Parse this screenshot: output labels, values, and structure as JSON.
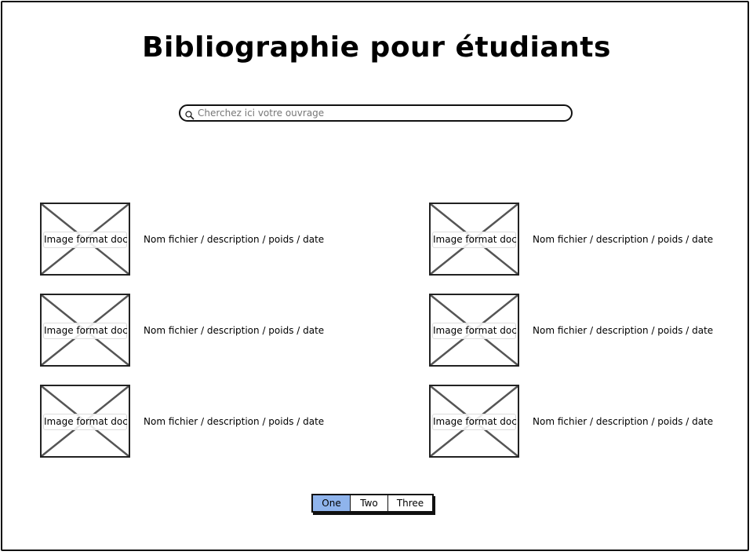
{
  "page": {
    "title": "Bibliographie pour étudiants"
  },
  "search": {
    "placeholder": "Cherchez ici votre ouvrage",
    "icon": "search-icon"
  },
  "documents": [
    {
      "thumb_label": "Image format doc",
      "description": "Nom fichier / description / poids / date"
    },
    {
      "thumb_label": "Image format doc",
      "description": "Nom fichier / description / poids / date"
    },
    {
      "thumb_label": "Image format doc",
      "description": "Nom fichier / description / poids / date"
    },
    {
      "thumb_label": "Image format doc",
      "description": "Nom fichier / description / poids / date"
    },
    {
      "thumb_label": "Image format doc",
      "description": "Nom fichier / description / poids / date"
    },
    {
      "thumb_label": "Image format doc",
      "description": "Nom fichier / description / poids / date"
    }
  ],
  "pagination": {
    "pages": [
      "One",
      "Two",
      "Three"
    ],
    "active": "One",
    "active_color": "#8fb4ec"
  }
}
